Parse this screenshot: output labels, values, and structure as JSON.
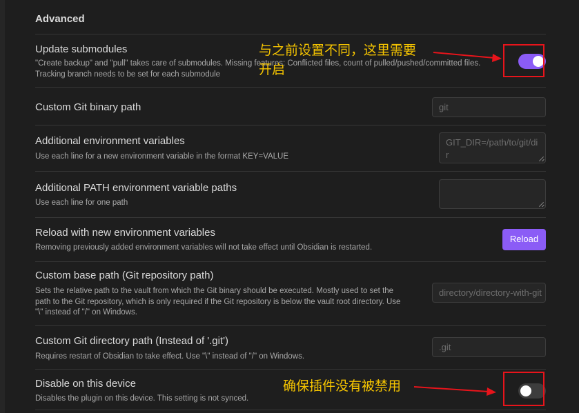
{
  "section_title": "Advanced",
  "settings": [
    {
      "name": "Update submodules",
      "desc": [
        "\"Create backup\" and \"pull\" takes care of submodules. Missing features: Conflicted files, count of pulled/pushed/committed files.",
        "Tracking branch needs to be set for each submodule"
      ]
    },
    {
      "name": "Custom Git binary path",
      "placeholder": "git"
    },
    {
      "name": "Additional environment variables",
      "desc": [
        "Use each line for a new environment variable in the format KEY=VALUE"
      ],
      "placeholder": "GIT_DIR=/path/to/git/dir"
    },
    {
      "name": "Additional PATH environment variable paths",
      "desc": [
        "Use each line for one path"
      ],
      "placeholder": ""
    },
    {
      "name": "Reload with new environment variables",
      "desc": [
        "Removing previously added environment variables will not take effect until Obsidian is restarted."
      ],
      "button_label": "Reload"
    },
    {
      "name": "Custom base path (Git repository path)",
      "desc": [
        "Sets the relative path to the vault from which the Git binary should be executed. Mostly used to set the",
        "path to the Git repository, which is only required if the Git repository is below the vault root directory. Use",
        "\"\\\" instead of \"/\" on Windows."
      ],
      "placeholder": "directory/directory-with-git"
    },
    {
      "name": "Custom Git directory path (Instead of '.git')",
      "desc": [
        "Requires restart of Obsidian to take effect. Use \"\\\" instead of \"/\" on Windows."
      ],
      "placeholder": ".git"
    },
    {
      "name": "Disable on this device",
      "desc": [
        "Disables the plugin on this device. This setting is not synced."
      ]
    }
  ],
  "toggles": {
    "update_submodules": true,
    "disable_on_device": false
  },
  "annotations": {
    "note_submodules": [
      "与之前设置不同，这里需要",
      "开启"
    ],
    "note_disable": "确保插件没有被禁用"
  },
  "colors": {
    "accent": "#8b5cf6",
    "annotation_text": "#f5c400",
    "annotation_mark": "#e8141b",
    "background": "#1e1e1e"
  }
}
